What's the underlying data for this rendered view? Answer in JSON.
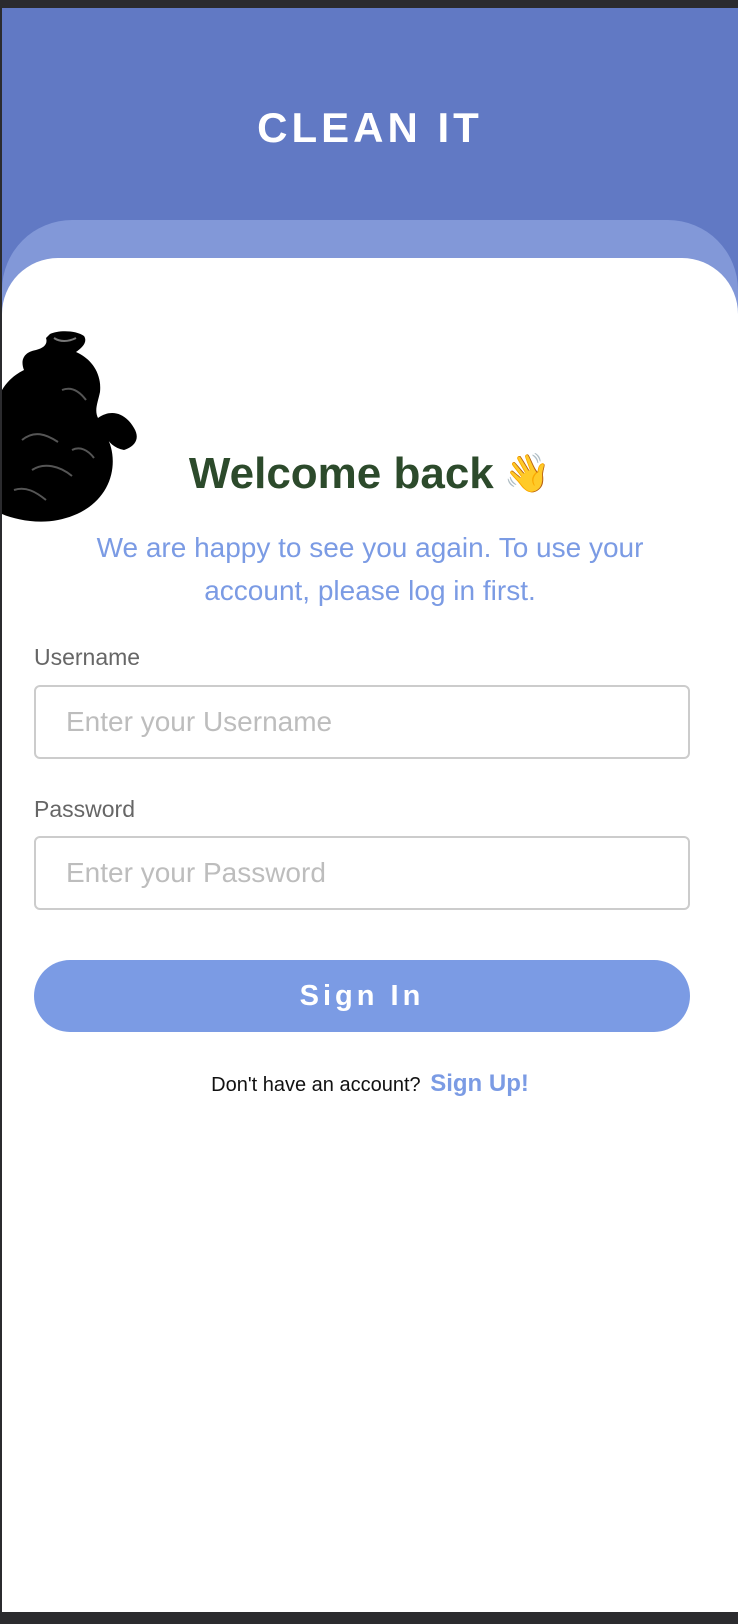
{
  "colors": {
    "header": "#6179c4",
    "card_back": "#8298d8",
    "accent": "#7b9be4",
    "button": "#7b9be4",
    "welcome": "#2c4a2b"
  },
  "header": {
    "title": "CLEAN IT"
  },
  "illustration": {
    "icon": "trash-bag-icon"
  },
  "welcome": {
    "title": "Welcome back",
    "emoji": "👋",
    "subtitle": "We are happy to see you again. To use your account, please log in first."
  },
  "form": {
    "username": {
      "label": "Username",
      "placeholder": "Enter your Username",
      "value": ""
    },
    "password": {
      "label": "Password",
      "placeholder": "Enter your Password",
      "value": ""
    },
    "submit_label": "Sign In"
  },
  "footer": {
    "prompt": "Don't have an account?",
    "link_label": "Sign Up!"
  }
}
